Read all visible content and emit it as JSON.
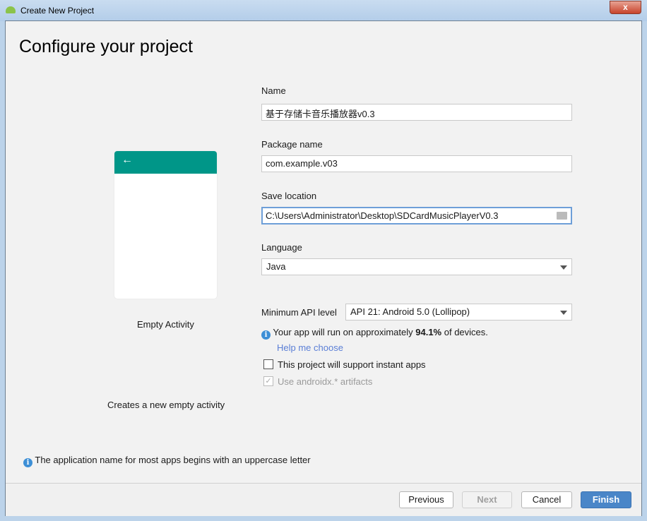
{
  "window": {
    "title": "Create New Project",
    "close": "x"
  },
  "page_title": "Configure your project",
  "template": {
    "name": "Empty Activity",
    "description": "Creates a new empty activity",
    "back_icon": "arrow-left-icon"
  },
  "form": {
    "name_label": "Name",
    "name_value": "基于存储卡音乐播放器v0.3",
    "package_label": "Package name",
    "package_value": "com.example.v03",
    "location_label": "Save location",
    "location_value": "C:\\Users\\Administrator\\Desktop\\SDCardMusicPlayerV0.3",
    "language_label": "Language",
    "language_value": "Java",
    "api_label": "Minimum API level",
    "api_value": "API 21: Android 5.0 (Lollipop)",
    "coverage_pre": "Your app will run on approximately ",
    "coverage_value": "94.1%",
    "coverage_post": " of devices.",
    "help_link": "Help me choose",
    "instant_apps": "This project will support instant apps",
    "instant_apps_checked": false,
    "androidx": "Use androidx.* artifacts",
    "androidx_checked": true
  },
  "hint": "The application name for most apps begins with an uppercase letter",
  "buttons": {
    "previous": "Previous",
    "next": "Next",
    "cancel": "Cancel",
    "finish": "Finish"
  },
  "colors": {
    "accent": "#009688",
    "primary_button": "#4a86c8",
    "link": "#5b7fd6"
  }
}
